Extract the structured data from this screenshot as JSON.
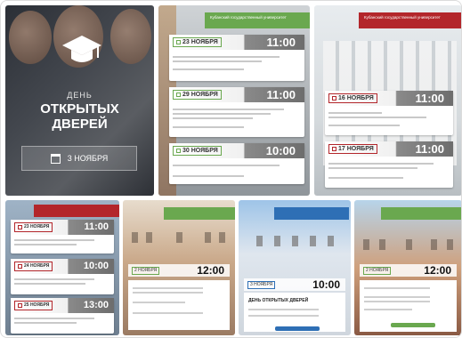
{
  "colors": {
    "green": "#6aa84f",
    "red": "#b3262b",
    "blue": "#2e6fb5"
  },
  "hero": {
    "title_small": "ДЕНЬ",
    "title_line1": "ОТКРЫТЫХ",
    "title_line2": "ДВЕРЕЙ",
    "date": "3 НОЯБРЯ",
    "icon": "graduation-cap-icon"
  },
  "tile2": {
    "banner": "Кубанский государственный университет",
    "events": [
      {
        "date": "23 НОЯБРЯ",
        "time": "11:00"
      },
      {
        "date": "29 НОЯБРЯ",
        "time": "11:00"
      },
      {
        "date": "30 НОЯБРЯ",
        "time": "10:00"
      }
    ]
  },
  "tile3": {
    "banner": "Кубанский государственный университет",
    "events": [
      {
        "date": "16 НОЯБРЯ",
        "time": "11:00"
      },
      {
        "date": "17 НОЯБРЯ",
        "time": "11:00"
      }
    ]
  },
  "tile4": {
    "events": [
      {
        "date": "23 НОЯБРЯ",
        "time": "11:00"
      },
      {
        "date": "24 НОЯБРЯ",
        "time": "10:00"
      },
      {
        "date": "25 НОЯБРЯ",
        "time": "13:00"
      }
    ]
  },
  "tile5": {
    "date": "2 НОЯБРЯ",
    "time": "12:00"
  },
  "tile6": {
    "date": "3 НОЯБРЯ",
    "time": "10:00",
    "heading": "ДЕНЬ ОТКРЫТЫХ ДВЕРЕЙ"
  },
  "tile7": {
    "date": "2 НОЯБРЯ",
    "time": "12:00"
  }
}
